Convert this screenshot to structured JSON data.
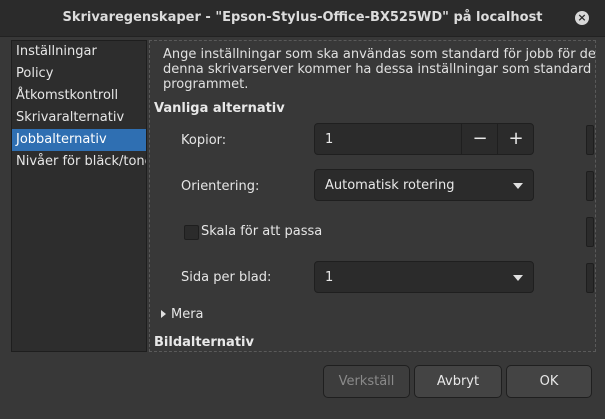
{
  "window": {
    "title": "Skrivaregenskaper - \"Epson-Stylus-Office-BX525WD\" på localhost"
  },
  "sidebar": {
    "items": [
      {
        "label": "Inställningar"
      },
      {
        "label": "Policy"
      },
      {
        "label": "Åtkomstkontroll"
      },
      {
        "label": "Skrivaralternativ"
      },
      {
        "label": "Jobbalternativ",
        "selected": true
      },
      {
        "label": "Nivåer för bläck/toner"
      }
    ]
  },
  "panel": {
    "description_line1": "Ange inställningar som ska användas som standard för jobb för denna s",
    "description_line2": "denna skrivarserver kommer ha dessa inställningar som standard om de",
    "description_line3": "programmet.",
    "section_common": "Vanliga alternativ",
    "copies_label": "Kopior:",
    "copies_value": "1",
    "minus_symbol": "−",
    "plus_symbol": "+",
    "orientation_label": "Orientering:",
    "orientation_value": "Automatisk rotering",
    "fit_label": "Skala för att passa",
    "pages_per_sheet_label": "Sida per blad:",
    "pages_per_sheet_value": "1",
    "more_label": "Mera",
    "section_image": "Bildalternativ"
  },
  "buttons": {
    "apply": "Verkställ",
    "cancel": "Avbryt",
    "ok": "OK"
  },
  "colors": {
    "selection": "#2f6fb2",
    "background": "#383838"
  }
}
